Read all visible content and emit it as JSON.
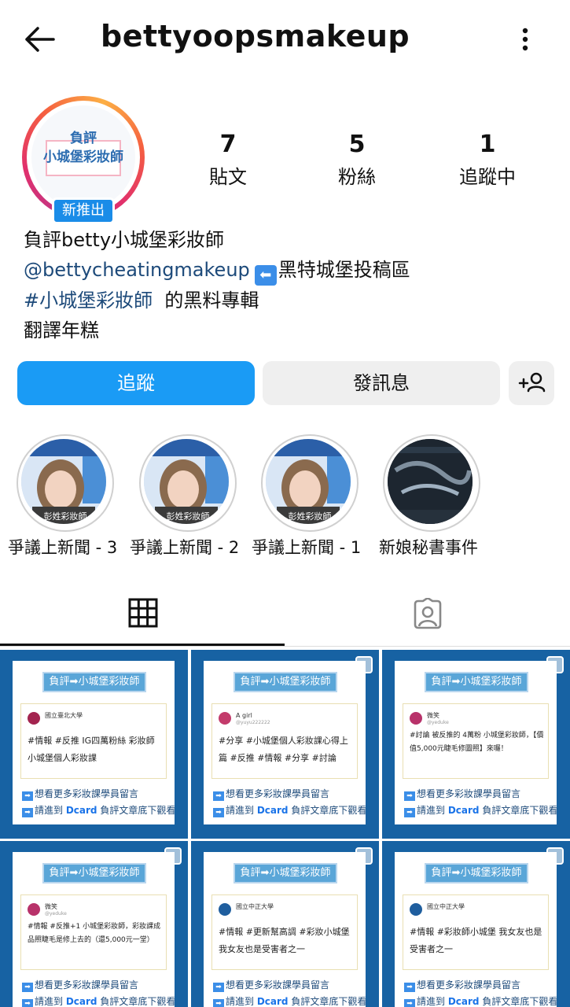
{
  "header": {
    "username": "bettyoopsmakeup"
  },
  "profile": {
    "avatar_line1": "負評",
    "avatar_line2": "小城堡彩妝師",
    "badge": "新推出",
    "stats": {
      "posts_count": "7",
      "posts_label": "貼文",
      "followers_count": "5",
      "followers_label": "粉絲",
      "following_count": "1",
      "following_label": "追蹤中"
    },
    "bio": {
      "name": "負評betty小城堡彩妝師",
      "mention": "@bettycheatingmakeup",
      "mention_suffix": "黑特城堡投稿區",
      "hashtag": "#小城堡彩妝師",
      "hashtag_suffix": "的黑料專輯",
      "line4": "翻譯年糕"
    }
  },
  "actions": {
    "follow": "追蹤",
    "message": "發訊息"
  },
  "highlights": [
    {
      "label": "爭議上新聞 - 3",
      "caption": "彭姓彩妝師"
    },
    {
      "label": "爭議上新聞 - 2",
      "caption": "彭姓彩妝師"
    },
    {
      "label": "爭議上新聞 - 1",
      "caption": "彭姓彩妝師"
    },
    {
      "label": "新娘秘書事件",
      "caption": ""
    }
  ],
  "colors": {
    "follow_blue": "#1a9bf5",
    "post_bg": "#1762a3",
    "title_blue": "#5aa6d8"
  },
  "posts": [
    {
      "title": "負評➡小城堡彩妝師",
      "author": "國立臺北大學",
      "handle": "",
      "text": "#情報 #反推 IG四萬粉絲 彩妝師小城堡個人彩妝課",
      "cta1": "想看更多彩妝課學員留言",
      "cta2_pre": "請進到",
      "cta2_brand": "Dcard",
      "cta2_post": "負評文章底下觀看"
    },
    {
      "title": "負評➡小城堡彩妝師",
      "author": "A girl",
      "handle": "@yuyu222222",
      "text": "#分享 #小城堡個人彩妝課心得上篇 #反推 #情報 #分享 #討論",
      "cta1": "想看更多彩妝課學員留言",
      "cta2_pre": "請進到",
      "cta2_brand": "Dcard",
      "cta2_post": "負評文章底下觀看"
    },
    {
      "title": "負評➡小城堡彩妝師",
      "author": "微笑",
      "handle": "@yeduke",
      "text": "#討論 被反推的 4萬粉 小城堡彩妝師，【價值5,000元睫毛修圖照】來囉！",
      "cta1": "想看更多彩妝課學員留言",
      "cta2_pre": "請進到",
      "cta2_brand": "Dcard",
      "cta2_post": "負評文章底下觀看"
    },
    {
      "title": "負評➡小城堡彩妝師",
      "author": "微笑",
      "handle": "@yeduke",
      "text": "#情報 #反推+1 小城堡彩妝師，彩妝課成品照睫毛是修上去的（還5,000元一堂）",
      "cta1": "想看更多彩妝課學員留言",
      "cta2_pre": "請進到",
      "cta2_brand": "Dcard",
      "cta2_post": "負評文章底下觀看"
    },
    {
      "title": "負評➡小城堡彩妝師",
      "author": "國立中正大學",
      "handle": "",
      "text": "#情報 #更新幫高調 #彩妝小城堡 我女友也是受害者之一",
      "cta1": "想看更多彩妝課學員留言",
      "cta2_pre": "請進到",
      "cta2_brand": "Dcard",
      "cta2_post": "負評文章底下觀看"
    },
    {
      "title": "負評➡小城堡彩妝師",
      "author": "國立中正大學",
      "handle": "",
      "text": "#情報 #彩妝師小城堡 我女友也是受害者之一",
      "cta1": "想看更多彩妝課學員留言",
      "cta2_pre": "請進到",
      "cta2_brand": "Dcard",
      "cta2_post": "負評文章底下觀看"
    }
  ]
}
